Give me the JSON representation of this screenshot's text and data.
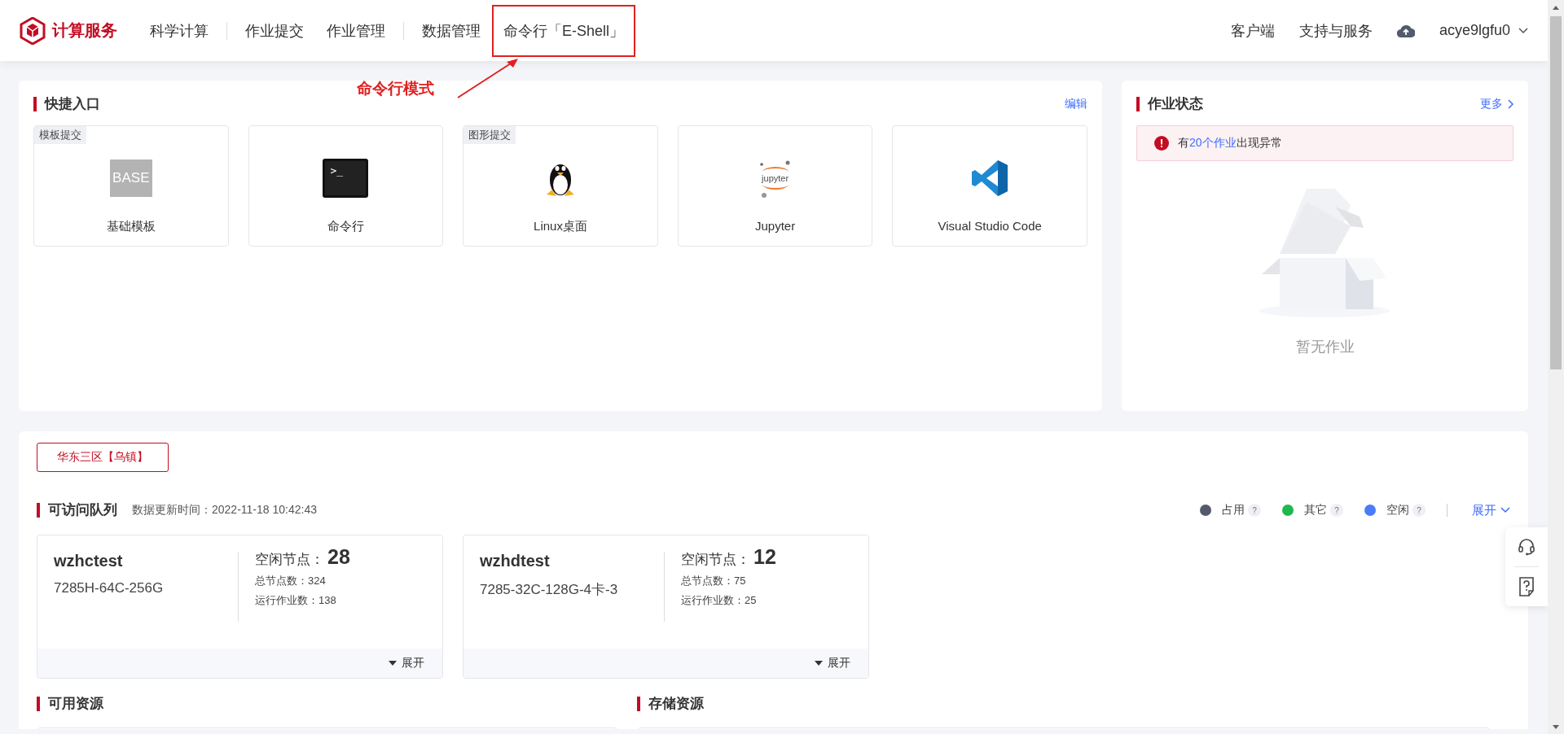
{
  "header": {
    "logo_text": "计算服务",
    "nav": [
      {
        "label": "科学计算",
        "selected": false,
        "divider_before": false,
        "annotated": false
      },
      {
        "label": "作业提交",
        "selected": false,
        "divider_before": true,
        "annotated": false
      },
      {
        "label": "作业管理",
        "selected": false,
        "divider_before": false,
        "annotated": false
      },
      {
        "label": "数据管理",
        "selected": false,
        "divider_before": true,
        "annotated": false
      },
      {
        "label": "命令行「E-Shell」",
        "selected": false,
        "divider_before": false,
        "annotated": true
      }
    ],
    "links": [
      "客户端",
      "支持与服务"
    ],
    "user": "acye9lgfu0"
  },
  "annotation": {
    "text": "命令行模式"
  },
  "quick_entry": {
    "title": "快捷入口",
    "action": "编辑",
    "items": [
      {
        "label": "基础模板",
        "tag": "模板提交",
        "kind": "base",
        "icon_text": "BASE"
      },
      {
        "label": "命令行",
        "kind": "terminal",
        "icon_text": ">_"
      },
      {
        "label": "Linux桌面",
        "tag": "图形提交",
        "kind": "linux"
      },
      {
        "label": "Jupyter",
        "kind": "jupyter",
        "icon_text": "jupyter"
      },
      {
        "label": "Visual Studio Code",
        "kind": "vscode"
      }
    ]
  },
  "job_status": {
    "title": "作业状态",
    "more": "更多",
    "alert": {
      "prefix": "有",
      "link": "20个作业",
      "suffix": "出现异常"
    },
    "empty_text": "暂无作业"
  },
  "region_button": "华东三区【乌镇】",
  "queues": {
    "title": "可访问队列",
    "updated": "数据更新时间：2022-11-18 10:42:43",
    "legend": [
      {
        "label": "占用",
        "color": "#545a6d"
      },
      {
        "label": "其它",
        "color": "#1fb84f"
      },
      {
        "label": "空闲",
        "color": "#4a7cf6"
      }
    ],
    "help_mark": "?",
    "expand": "展开",
    "cards": [
      {
        "name": "wzhctest",
        "spec": "7285H-64C-256G",
        "idle_label": "空闲节点：",
        "idle": "28",
        "total": "总节点数：324",
        "running": "运行作业数：138",
        "expand": "展开"
      },
      {
        "name": "wzhdtest",
        "spec": "7285-32C-128G-4卡-3",
        "idle_label": "空闲节点：",
        "idle": "12",
        "total": "总节点数：75",
        "running": "运行作业数：25",
        "expand": "展开"
      }
    ]
  },
  "sections": [
    "可用资源",
    "存储资源"
  ]
}
